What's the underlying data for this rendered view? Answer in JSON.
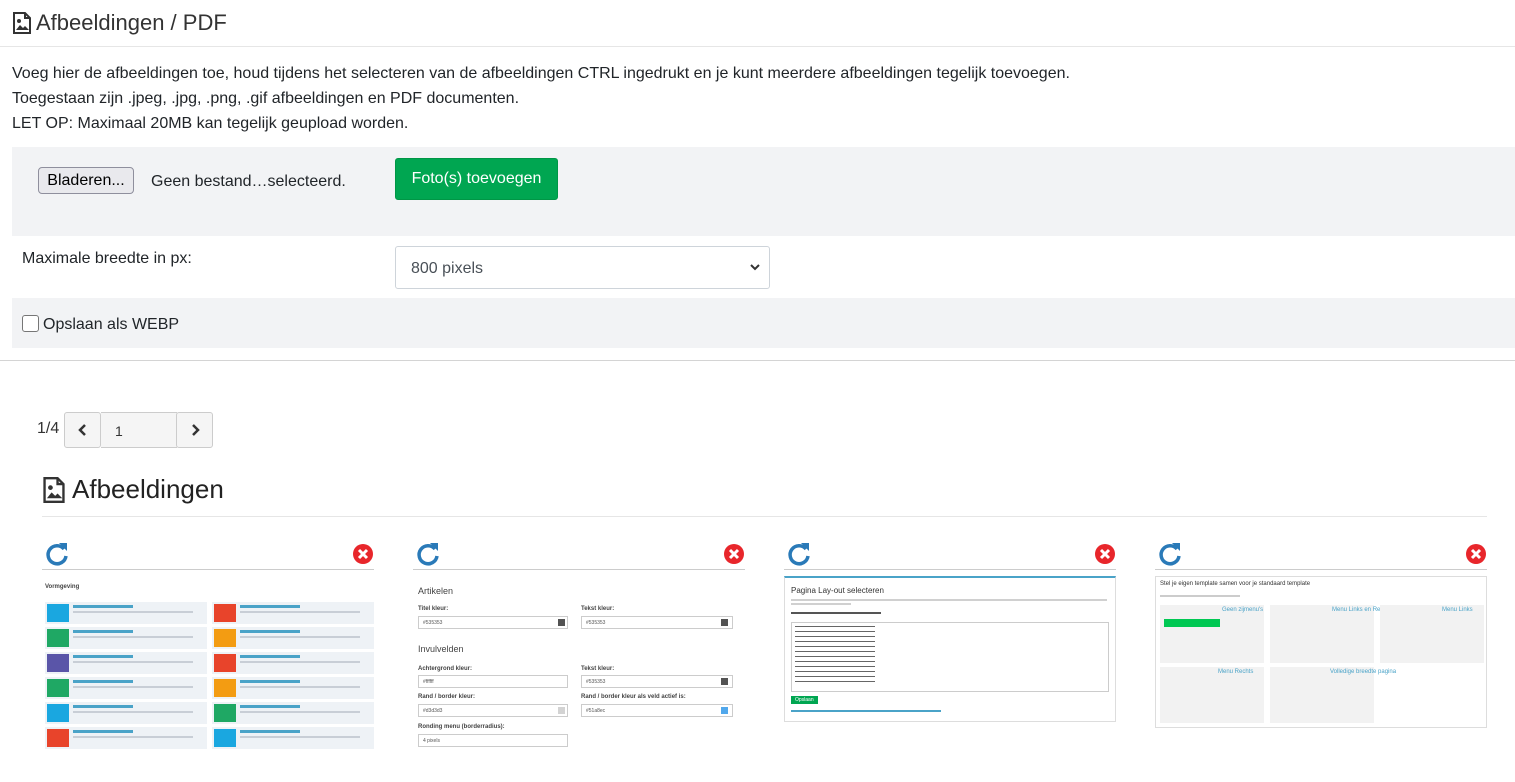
{
  "header": {
    "title": "Afbeeldingen / PDF"
  },
  "intro": {
    "line1": "Voeg hier de afbeeldingen toe, houd tijdens het selecteren van de afbeeldingen CTRL ingedrukt en je kunt meerdere afbeeldingen tegelijk toevoegen.",
    "line2": "Toegestaan zijn .jpeg, .jpg, .png, .gif afbeeldingen en PDF documenten.",
    "line3": "LET OP: Maximaal 20MB kan tegelijk geupload worden."
  },
  "upload": {
    "browse_label": "Bladeren...",
    "file_status": "Geen bestand…selecteerd.",
    "add_label": "Foto(s) toevoegen"
  },
  "max_width": {
    "label": "Maximale breedte in px:",
    "selected": "800 pixels"
  },
  "webp": {
    "label": "Opslaan als WEBP",
    "checked": false
  },
  "pager": {
    "label": "1/4",
    "page": "1"
  },
  "section": {
    "title": "Afbeeldingen"
  },
  "colors": {
    "accent_green": "#00a651",
    "refresh_blue": "#2a7ab8",
    "delete_red": "#e8262b"
  },
  "thumb1": {
    "heading": "Vormgeving"
  },
  "thumb2": {
    "s1": "Artikelen",
    "title_color_label": "Titel kleur:",
    "title_color": "#535353",
    "text_color_label": "Tekst kleur:",
    "text_color": "#535353",
    "s2": "Invulvelden",
    "bg_label": "Achtergrond kleur:",
    "bg_value": "#ffffff",
    "text2_label": "Tekst kleur:",
    "text2_value": "#535353",
    "border_label": "Rand / border kleur:",
    "border_value": "#d3d3d3",
    "border_active_label": "Rand / border kleur als veld actief is:",
    "border_active_value": "#51a8ec",
    "radius_label": "Ronding menu (borderradius):",
    "radius_value": "4 pixels"
  },
  "thumb3": {
    "title": "Pagina Lay-out selecteren",
    "button": "Opslaan"
  },
  "thumb4": {
    "title": "Stel je eigen template samen voor je standaard template",
    "items": [
      "Geen zijmenu's",
      "Menu Links en Rechts",
      "Menu Links",
      "Menu Rechts",
      "Volledige breedte pagina"
    ]
  }
}
